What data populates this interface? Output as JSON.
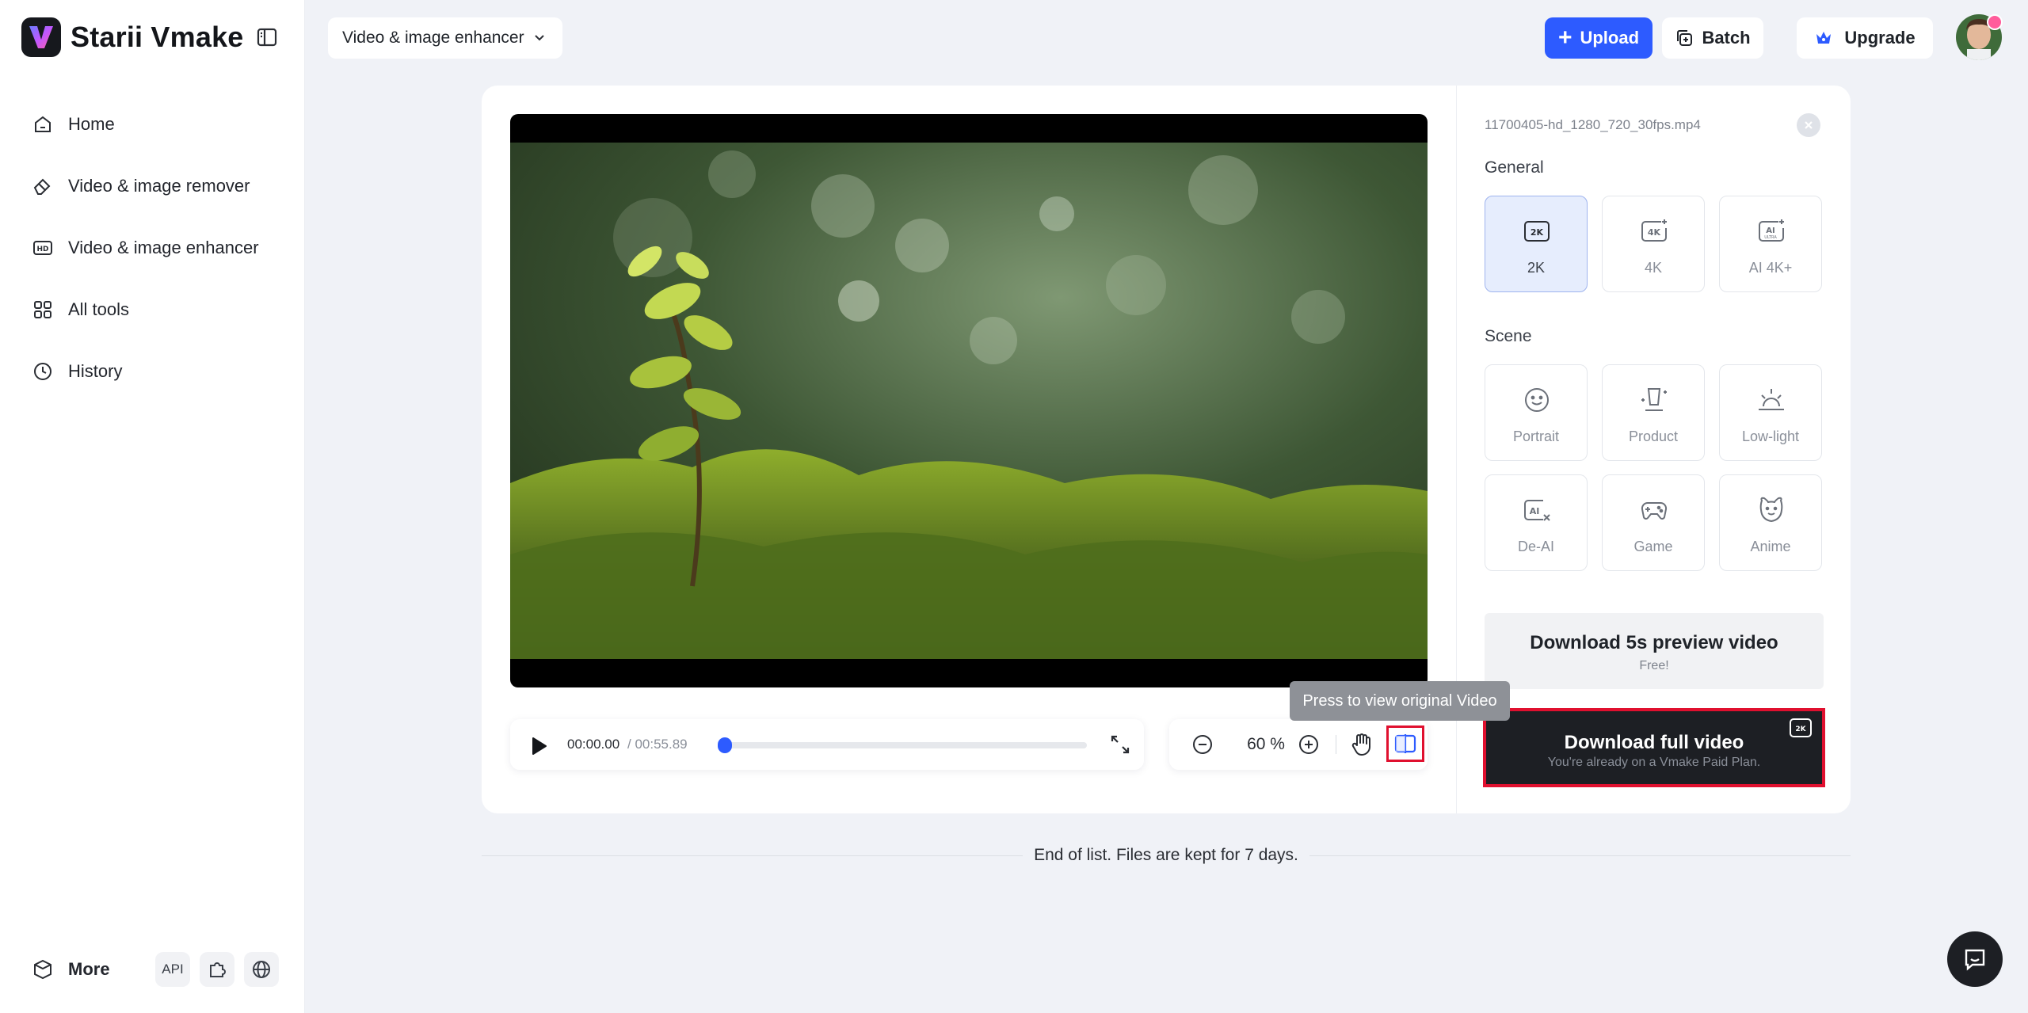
{
  "app": {
    "name": "Starii Vmake"
  },
  "sidebar": {
    "items": [
      {
        "label": "Home",
        "icon": "home-icon"
      },
      {
        "label": "Video & image remover",
        "icon": "eraser-icon"
      },
      {
        "label": "Video & image enhancer",
        "icon": "hd-icon"
      },
      {
        "label": "All tools",
        "icon": "grid-icon"
      },
      {
        "label": "History",
        "icon": "clock-icon"
      }
    ],
    "more_label": "More",
    "api_label": "API"
  },
  "header": {
    "tool_select": "Video & image enhancer",
    "upload_label": "Upload",
    "batch_label": "Batch",
    "upgrade_label": "Upgrade"
  },
  "player": {
    "current_time": "00:00.00",
    "total_time": "/ 00:55.89",
    "progress": 0.0,
    "zoom": "60 %",
    "tooltip": "Press to view original Video"
  },
  "panel": {
    "file_name": "11700405-hd_1280_720_30fps.mp4",
    "general_label": "General",
    "general_options": [
      {
        "label": "2K",
        "icon": "2k-icon",
        "selected": true
      },
      {
        "label": "4K",
        "icon": "4k-icon",
        "selected": false
      },
      {
        "label": "AI 4K+",
        "icon": "ai-ultra-icon",
        "selected": false
      }
    ],
    "scene_label": "Scene",
    "scene_options": [
      {
        "label": "Portrait",
        "icon": "smile-icon"
      },
      {
        "label": "Product",
        "icon": "product-icon"
      },
      {
        "label": "Low-light",
        "icon": "sunrise-icon"
      },
      {
        "label": "De-AI",
        "icon": "de-ai-icon"
      },
      {
        "label": "Game",
        "icon": "gamepad-icon"
      },
      {
        "label": "Anime",
        "icon": "bear-icon"
      }
    ],
    "preview_title": "Download 5s preview video",
    "preview_sub": "Free!",
    "full_title": "Download full video",
    "full_sub": "You're already on a Vmake Paid Plan."
  },
  "footer": {
    "end_text": "End of list. Files are kept for 7 days."
  },
  "colors": {
    "accent": "#2d5bff",
    "highlight": "#e0102f",
    "dark": "#1d1f24"
  }
}
